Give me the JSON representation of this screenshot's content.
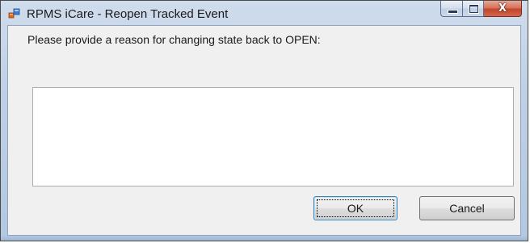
{
  "window": {
    "title": "RPMS iCare - Reopen Tracked Event",
    "icon": "app-icon",
    "caption_buttons": {
      "minimize_icon": "minimize-icon",
      "maximize_icon": "maximize-icon",
      "close_glyph": "X"
    }
  },
  "dialog": {
    "prompt": "Please provide a reason for changing state back to OPEN:",
    "reason_value": "",
    "ok_label": "OK",
    "cancel_label": "Cancel"
  },
  "colors": {
    "title_bar": "#bed0e6",
    "client_background": "#f0f0f0",
    "close_button": "#c2452a",
    "default_button_border": "#3c7fb1"
  }
}
